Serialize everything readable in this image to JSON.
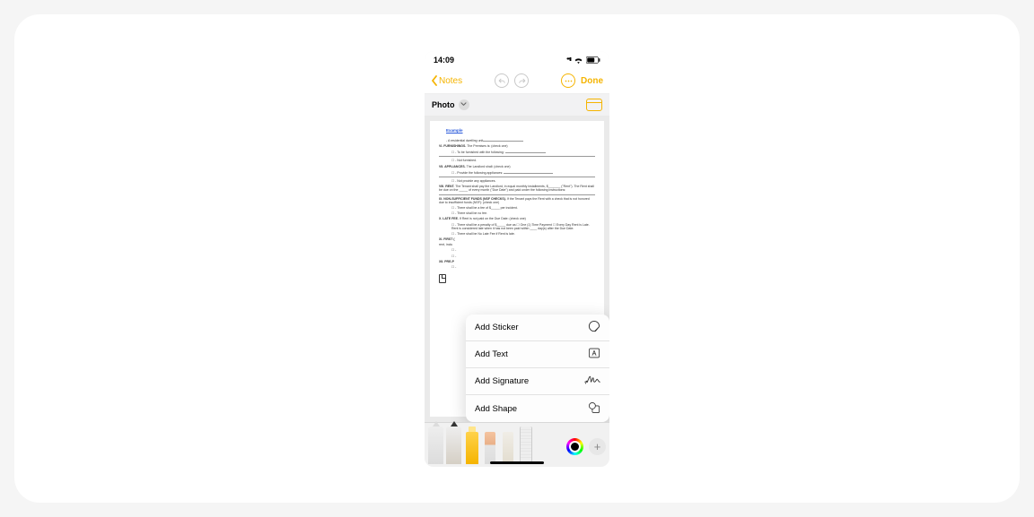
{
  "status": {
    "time": "14:09"
  },
  "nav": {
    "back": "Notes",
    "done": "Done"
  },
  "subbar": {
    "label": "Photo"
  },
  "doc": {
    "example": "Example",
    "l1_pre": "- A residential dwelling unit",
    "s7": "VI. FURNISHINGS.",
    "s7_after": "The Premises is: (check one)",
    "s7a": "☐ - To be furnished with the following:",
    "s7b": "☐ - Not furnished.",
    "s8": "VII. APPLIANCES.",
    "s8_after": "The Landlord shall: (check one)",
    "s8a": "☐ - Provide the following appliances:",
    "s8b": "☐ - Not provide any appliances.",
    "s9": "VIII. RENT.",
    "s9_body": "The Tenant shall pay the Landlord, in equal monthly installments, $_______ (\"Rent\"). The Rent shall be due on the _____ of every month (\"Due Date\") and paid under the following instructions:",
    "s10": "IX. NON-SUFFICIENT FUNDS (NSF CHECKS).",
    "s10_body": "If the Tenant pays the Rent with a check that is not honored due to insufficient funds (NSF): (check one)",
    "s10a": "☐ - There shall be a fee of $_____ per incident.",
    "s10b": "☐ - There shall be no fee.",
    "s11": "X. LATE FEE.",
    "s11_body": "If Rent is not paid on the Due Date: (check one)",
    "s11a": "☐ - There shall be a penalty of $_____ due as ☐ One (1) Time Payment ☐ Every Day Rent is Late. Rent is considered late when it has not been paid within ____ day(s) after the Due Date.",
    "s11b": "☐ - There shall be No Late Fee if Rent is late.",
    "s12": "XI. FIRST (",
    "s12_body": "rent, inclu",
    "s13": "XII. PRE-P"
  },
  "popup": [
    {
      "label": "Add Sticker",
      "icon": "sticker"
    },
    {
      "label": "Add Text",
      "icon": "text"
    },
    {
      "label": "Add Signature",
      "icon": "signature"
    },
    {
      "label": "Add Shape",
      "icon": "shape"
    }
  ]
}
